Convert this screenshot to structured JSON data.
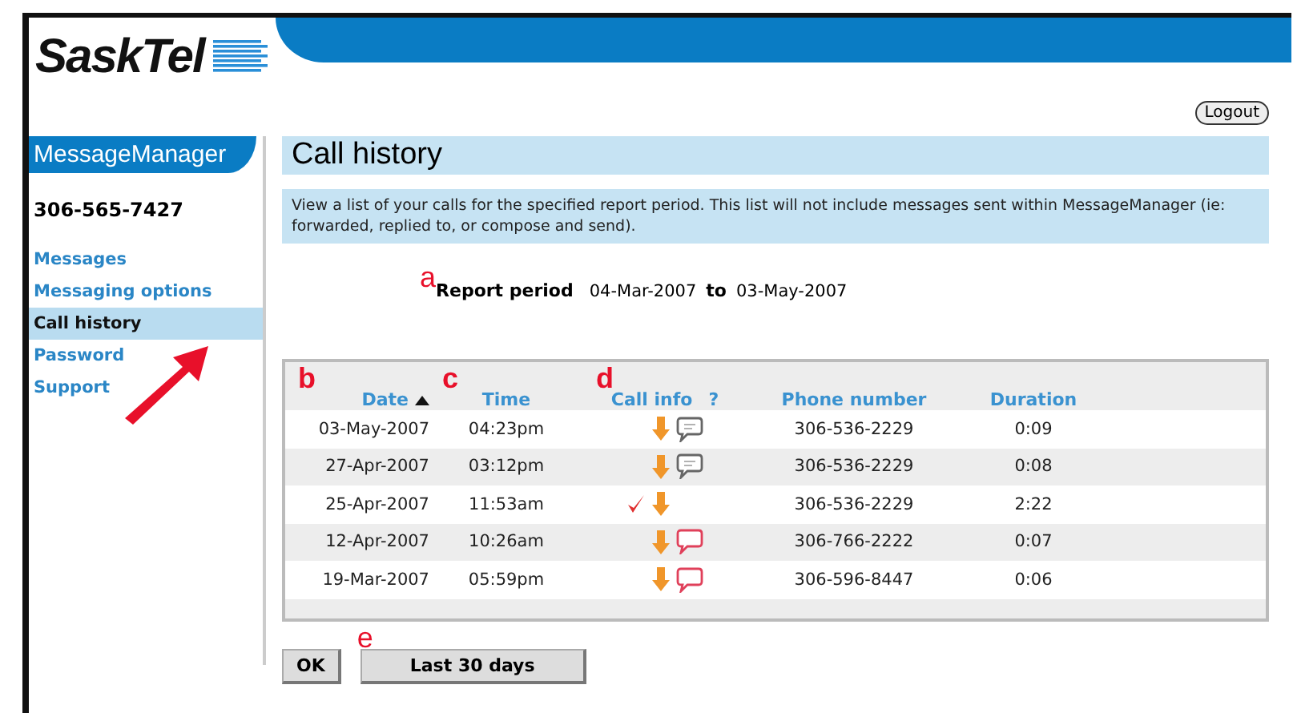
{
  "logo": "SaskTel",
  "logout": "Logout",
  "sidebar": {
    "title": "MessageManager",
    "phone": "306-565-7427",
    "items": [
      {
        "label": "Messages",
        "selected": false
      },
      {
        "label": "Messaging options",
        "selected": false
      },
      {
        "label": "Call history",
        "selected": true
      },
      {
        "label": "Password",
        "selected": false
      },
      {
        "label": "Support",
        "selected": false
      }
    ]
  },
  "page_title": "Call history",
  "description": "View a list of your calls for the specified report period. This list will not include messages sent within MessageManager (ie: forwarded, replied to, or compose and send).",
  "report_period": {
    "label": "Report period",
    "from": "04-Mar-2007",
    "joiner": "to",
    "to": "03-May-2007"
  },
  "annotations": [
    "a",
    "b",
    "c",
    "d",
    "e"
  ],
  "table": {
    "columns": [
      {
        "label": "Date",
        "sorted": true
      },
      {
        "label": "Time",
        "sorted": false
      },
      {
        "label": "Call info",
        "help": "?",
        "sorted": false
      },
      {
        "label": "Phone number",
        "sorted": false
      },
      {
        "label": "Duration",
        "sorted": false
      }
    ],
    "rows": [
      {
        "date": "03-May-2007",
        "time": "04:23pm",
        "kind": "read",
        "phone": "306-536-2229",
        "duration": "0:09"
      },
      {
        "date": "27-Apr-2007",
        "time": "03:12pm",
        "kind": "read",
        "phone": "306-536-2229",
        "duration": "0:08"
      },
      {
        "date": "25-Apr-2007",
        "time": "11:53am",
        "kind": "returned",
        "phone": "306-536-2229",
        "duration": "2:22"
      },
      {
        "date": "12-Apr-2007",
        "time": "10:26am",
        "kind": "new",
        "phone": "306-766-2222",
        "duration": "0:07"
      },
      {
        "date": "19-Mar-2007",
        "time": "05:59pm",
        "kind": "new",
        "phone": "306-596-8447",
        "duration": "0:06"
      }
    ]
  },
  "buttons": [
    "OK",
    "Last 30 days"
  ]
}
